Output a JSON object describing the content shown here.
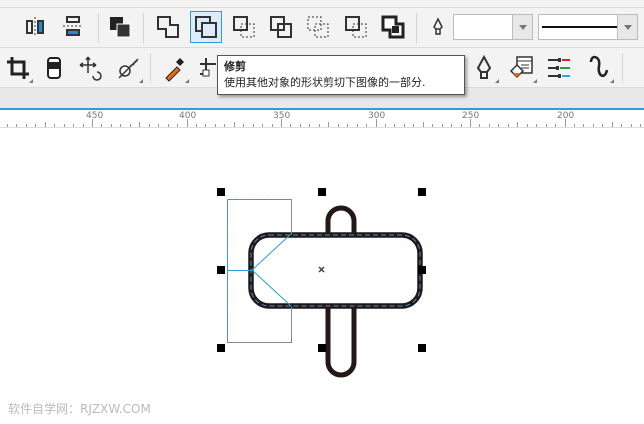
{
  "toolbar_row1": {
    "icons": [
      "mirror-horizontal-icon",
      "mirror-vertical-icon",
      "combine-icon",
      "weld-icon",
      "trim-icon",
      "intersect-icon",
      "simplify-icon",
      "front-minus-back-icon",
      "back-minus-front-icon",
      "boundary-icon",
      "outline-pen-icon"
    ],
    "selected": "trim-icon"
  },
  "toolbar_row2": {
    "icons": [
      "crop-icon",
      "eraser-icon",
      "free-transform-icon",
      "smear-icon",
      "eyedropper-icon",
      "dimension-icon",
      "pen-icon",
      "fill-icon",
      "object-properties-icon",
      "curve-icon"
    ]
  },
  "tooltip": {
    "title": "修剪",
    "text": "使用其他对象的形状剪切下图像的一部分."
  },
  "ruler": {
    "labels": [
      "450",
      "400",
      "350",
      "300",
      "250",
      "200"
    ]
  },
  "watermark": "软件自学网：RJZXW.COM",
  "colors": {
    "accent": "#2c9be0",
    "shape_stroke": "#231815"
  }
}
